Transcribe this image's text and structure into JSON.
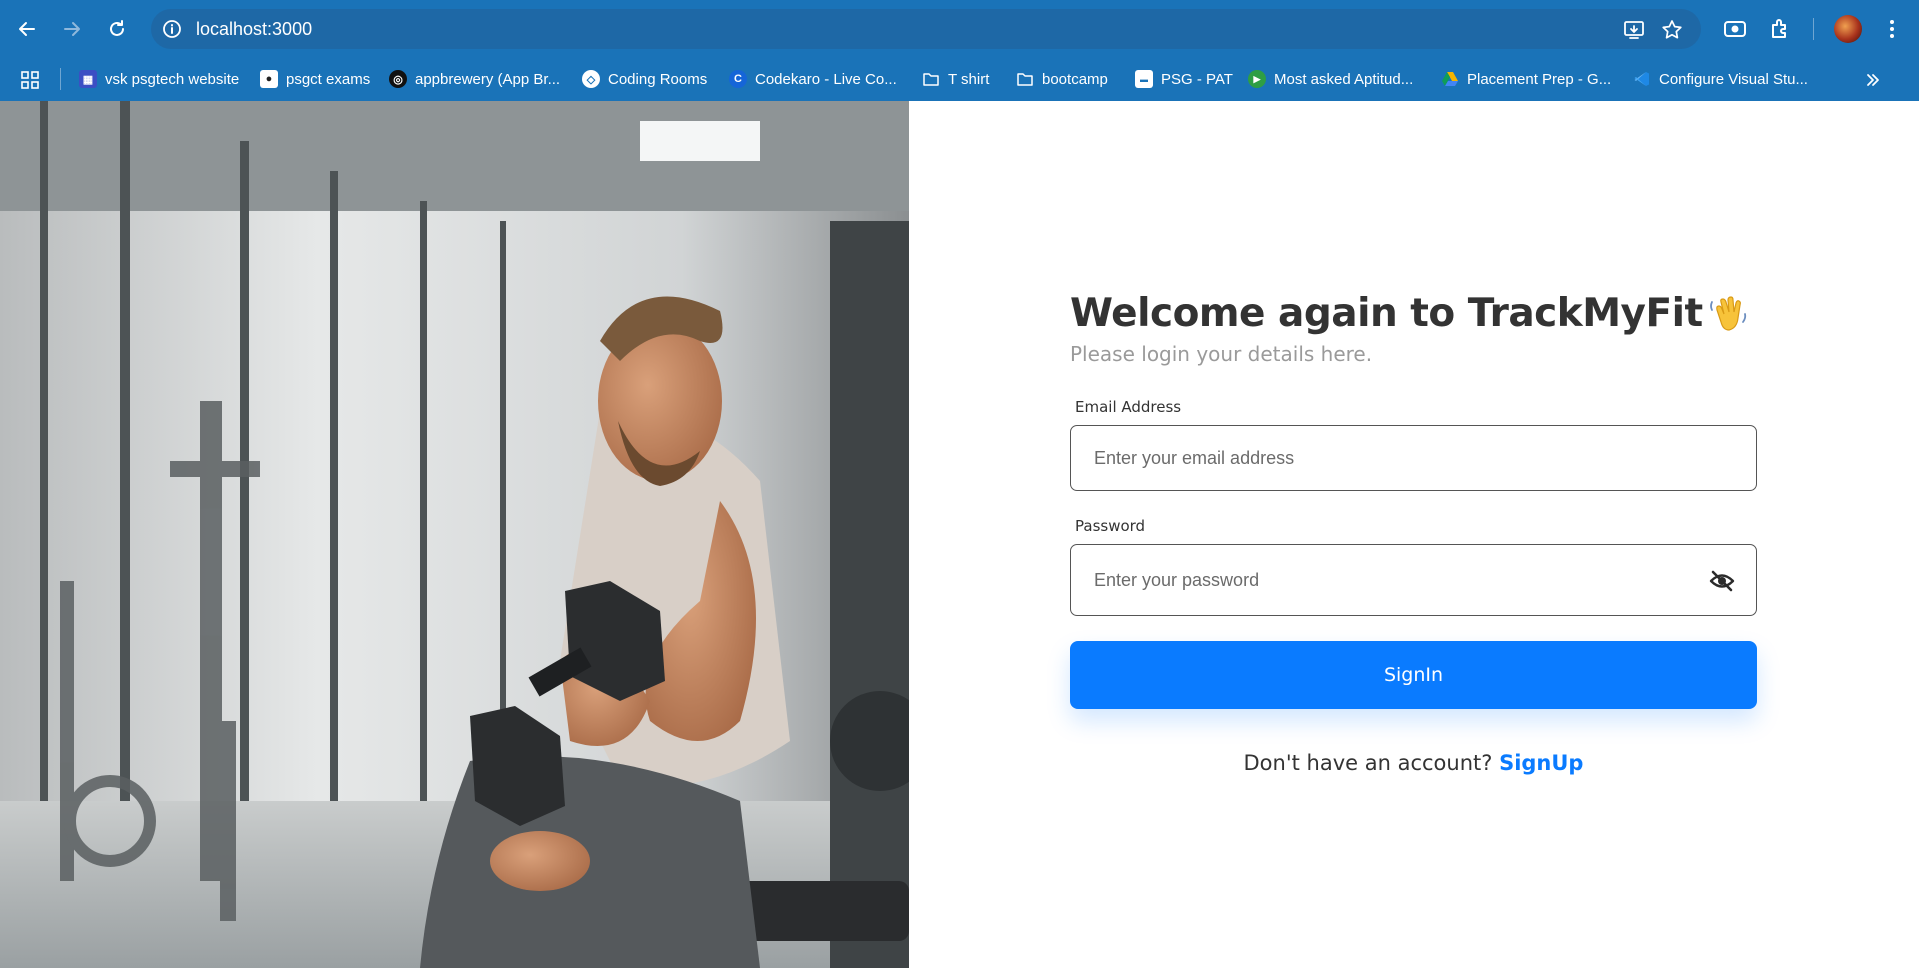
{
  "browser": {
    "url": "localhost:3000",
    "bookmarks": [
      {
        "label": "vsk psgtech website",
        "icon": "site-icon",
        "color": "#3b4fc4"
      },
      {
        "label": "psgct exams",
        "icon": "panda-icon",
        "color": "#444444"
      },
      {
        "label": "appbrewery (App Br...",
        "icon": "appbrewery-icon",
        "color": "#111111"
      },
      {
        "label": "Coding Rooms",
        "icon": "codingrooms-icon",
        "color": "#ffffff"
      },
      {
        "label": "Codekaro - Live Co...",
        "icon": "codekaro-icon",
        "color": "#1565d8"
      },
      {
        "label": "T shirt",
        "icon": "folder-icon",
        "color": "none"
      },
      {
        "label": "bootcamp",
        "icon": "folder-icon",
        "color": "none"
      },
      {
        "label": "PSG - PAT",
        "icon": "psgpat-icon",
        "color": "#ffffff"
      },
      {
        "label": "Most asked Aptitud...",
        "icon": "play-icon",
        "color": "#2e9e44"
      },
      {
        "label": "Placement Prep - G...",
        "icon": "drive-icon",
        "color": "#f4b400"
      },
      {
        "label": "Configure Visual Stu...",
        "icon": "vscode-icon",
        "color": "#1e88e5"
      }
    ]
  },
  "login": {
    "title": "Welcome again to TrackMyFit",
    "subtitle": "Please login your details here.",
    "email_label": "Email Address",
    "email_placeholder": "Enter your email address",
    "email_value": "",
    "password_label": "Password",
    "password_placeholder": "Enter your password",
    "password_value": "",
    "signin_label": "SignIn",
    "signup_prompt": "Don't have an account?",
    "signup_link": "SignUp"
  },
  "colors": {
    "chrome": "#1a73b8",
    "accent": "#0a7bff",
    "title": "#333333",
    "subtitle": "#9a9a9a"
  }
}
